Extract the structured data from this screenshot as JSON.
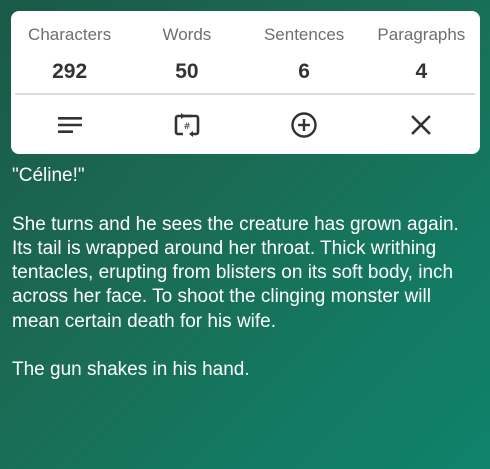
{
  "stats": [
    {
      "label": "Characters",
      "value": "292"
    },
    {
      "label": "Words",
      "value": "50"
    },
    {
      "label": "Sentences",
      "value": "6"
    },
    {
      "label": "Paragraphs",
      "value": "4"
    }
  ],
  "toolbar": {
    "icons": [
      "align-left-icon",
      "word-count-toggle-icon",
      "add-circle-icon",
      "close-icon"
    ],
    "icon_color": "#333333"
  },
  "content": {
    "paragraphs": [
      "\"Céline!\"",
      "She turns and he sees the creature has grown again. Its tail is wrapped around her throat. Thick writhing tentacles, erupting from blisters on its soft body, inch across her face.  To shoot the clinging monster will mean certain death for his wife.",
      "The gun shakes in his hand."
    ]
  },
  "colors": {
    "background": "#1b6a53",
    "card": "#ffffff",
    "text": "#ffffff"
  }
}
